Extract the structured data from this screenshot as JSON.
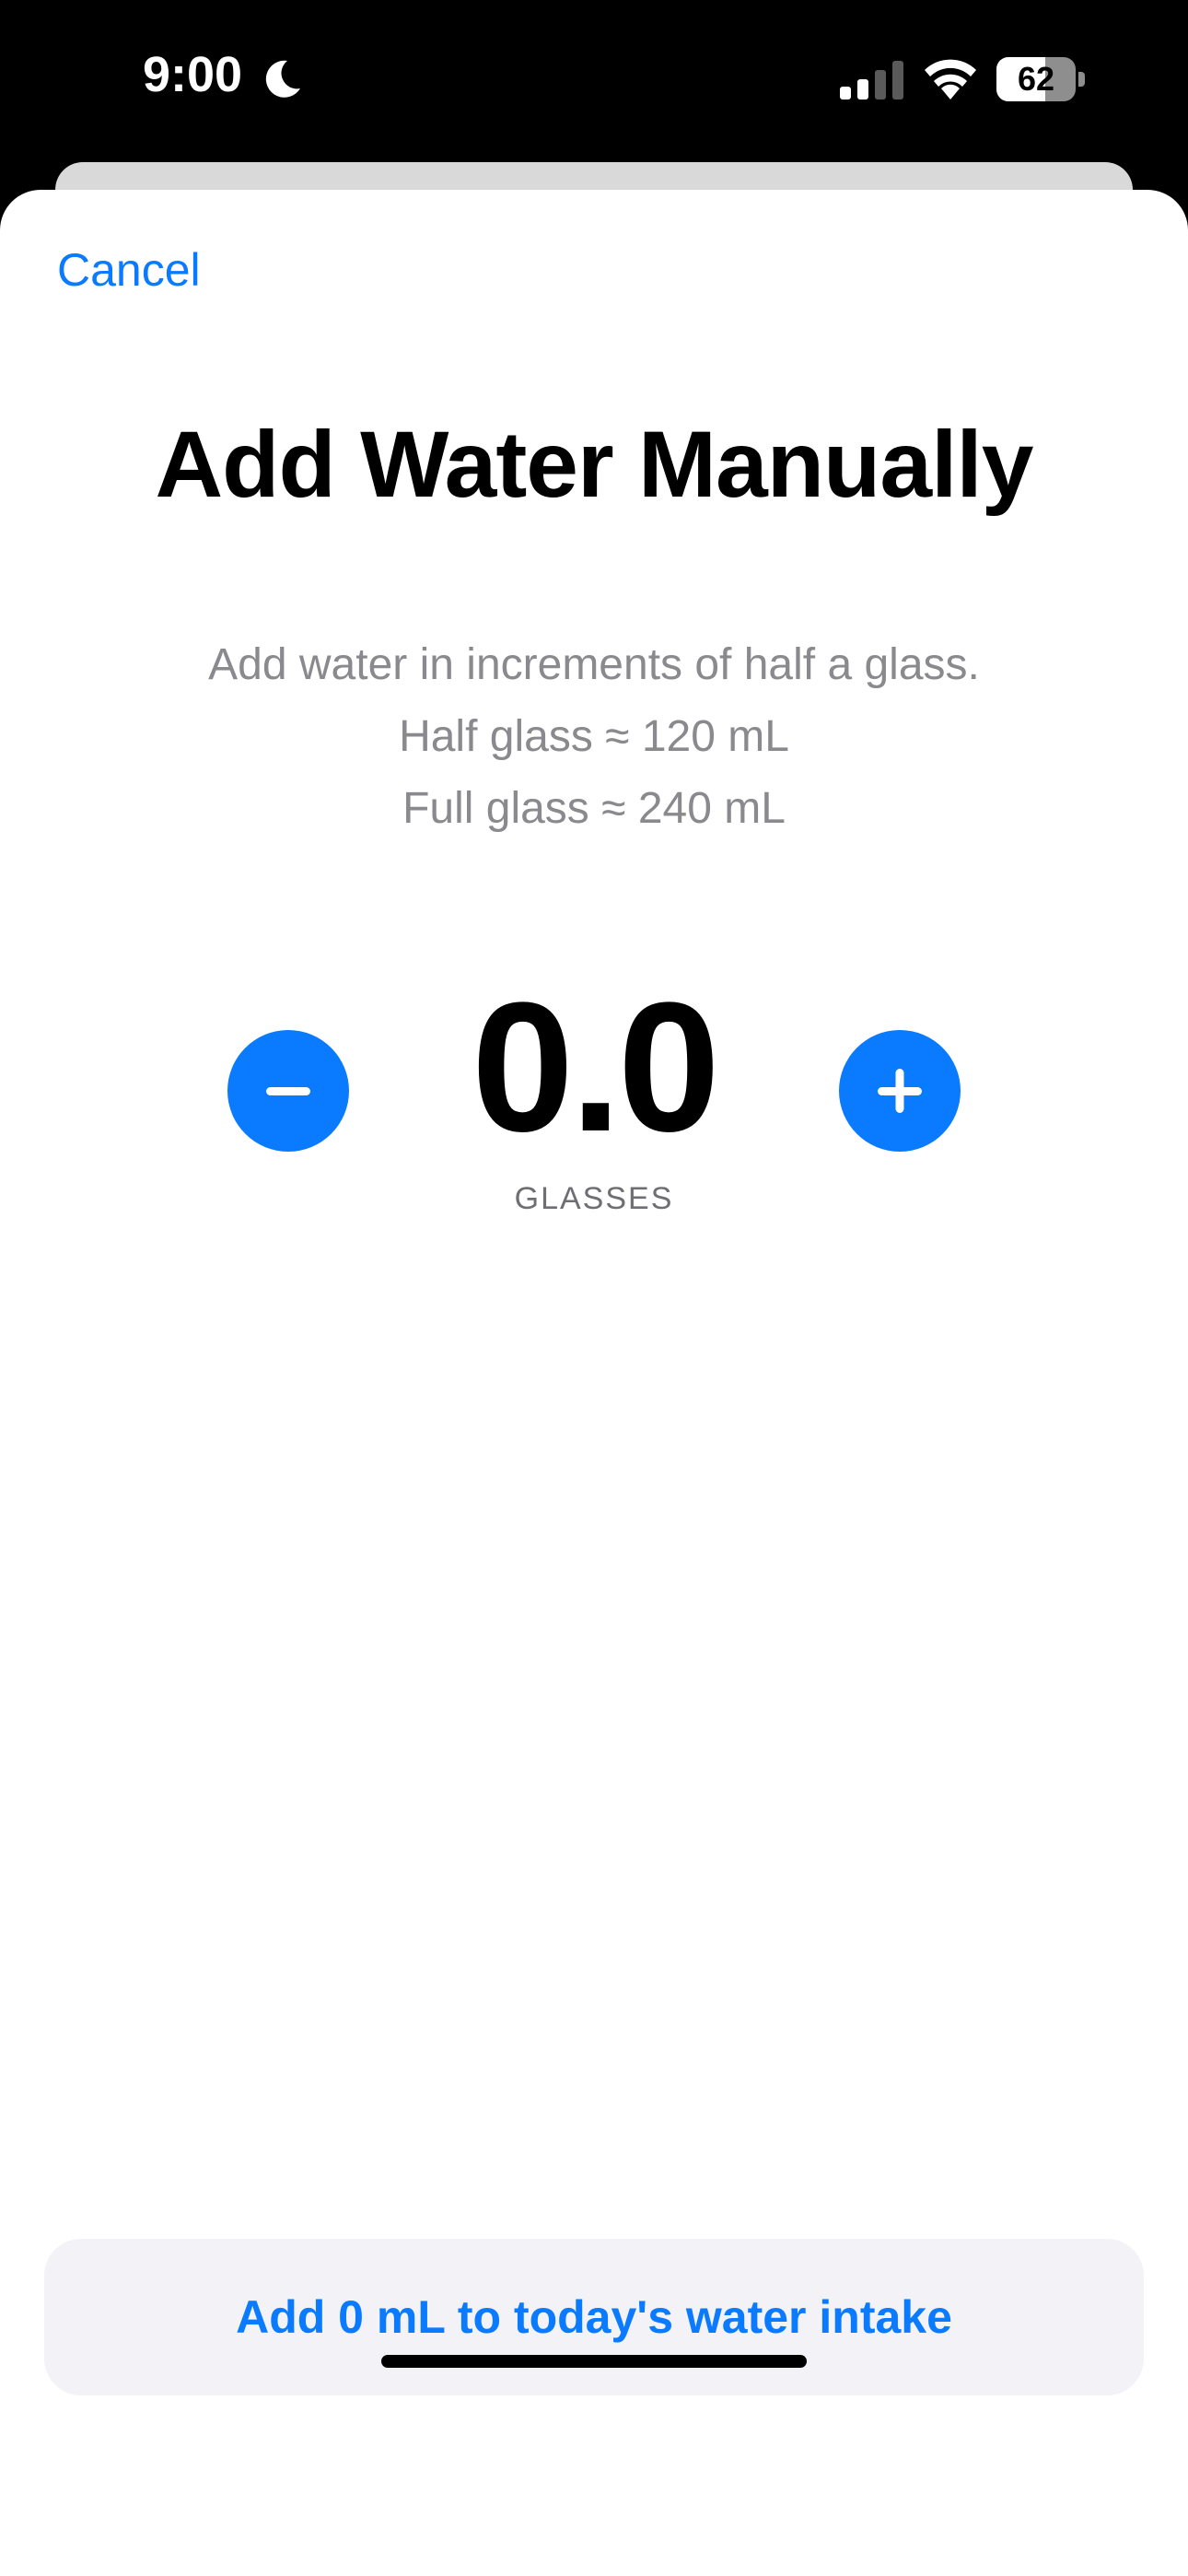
{
  "status_bar": {
    "time": "9:00",
    "battery_level": "62",
    "battery_fraction": 0.62,
    "icons": [
      "moon-icon",
      "signal-icon",
      "wifi-icon",
      "battery-icon"
    ]
  },
  "nav": {
    "cancel_label": "Cancel"
  },
  "main": {
    "title": "Add Water Manually",
    "description": [
      "Add water in increments of half a glass.",
      "Half glass ≈ 120 mL",
      "Full glass ≈ 240 mL"
    ],
    "stepper": {
      "value": "0.0",
      "unit": "GLASSES",
      "decrement_icon": "minus-icon",
      "increment_icon": "plus-icon"
    }
  },
  "footer": {
    "add_button_label": "Add 0 mL to today's water intake"
  },
  "colors": {
    "accent": "#0a7aff",
    "secondary_text": "#8a8a8e",
    "button_background": "#f2f2f7"
  }
}
